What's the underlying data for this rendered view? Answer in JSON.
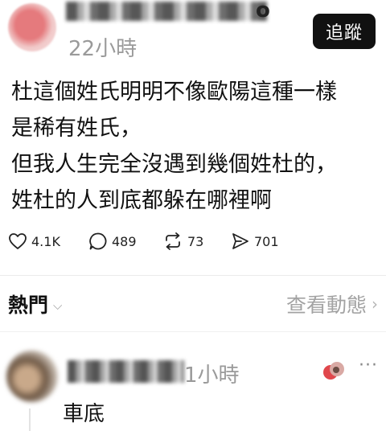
{
  "post": {
    "username_suffix": "o",
    "time": "22小時",
    "follow_label": "追蹤",
    "lines": [
      "杜這個姓氏明明不像歐陽這種一樣",
      "是稀有姓氏，",
      "但我人生完全沒遇到幾個姓杜的，",
      "姓杜的人到底都躲在哪裡啊"
    ]
  },
  "stats": {
    "likes": "4.1K",
    "comments": "489",
    "reposts": "73",
    "shares": "701"
  },
  "feed": {
    "hot_label": "熱門",
    "activity_label": "查看動態"
  },
  "comment": {
    "time": "1小時",
    "text": "車底"
  },
  "colors": {
    "accent": "#111111",
    "muted": "#9a9a9a",
    "reaction": "#e0474c"
  }
}
